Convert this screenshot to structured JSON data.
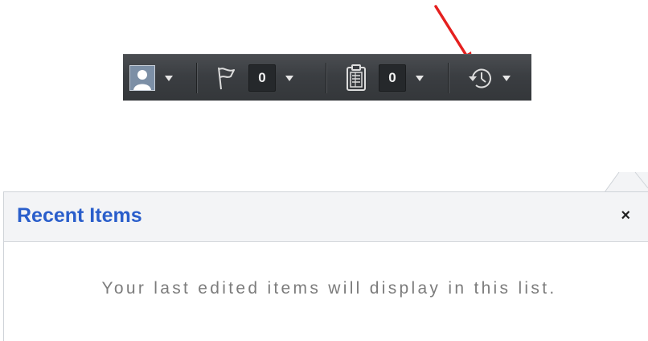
{
  "toolbar": {
    "user_menu": {
      "icon": "user-avatar-icon",
      "caret": "chevron-down-icon"
    },
    "flags": {
      "icon": "flag-icon",
      "count": "0"
    },
    "tasks": {
      "icon": "clipboard-icon",
      "count": "0"
    },
    "recent": {
      "icon": "history-clock-icon"
    }
  },
  "annotation": {
    "color": "#e5201f"
  },
  "recent_panel": {
    "title": "Recent Items",
    "close_glyph": "×",
    "empty_message": "Your last edited items will display in this list."
  },
  "colors": {
    "toolbar_bg": "#3b3e42",
    "title_blue": "#2a5ecb",
    "empty_text": "#7c7c7c"
  }
}
